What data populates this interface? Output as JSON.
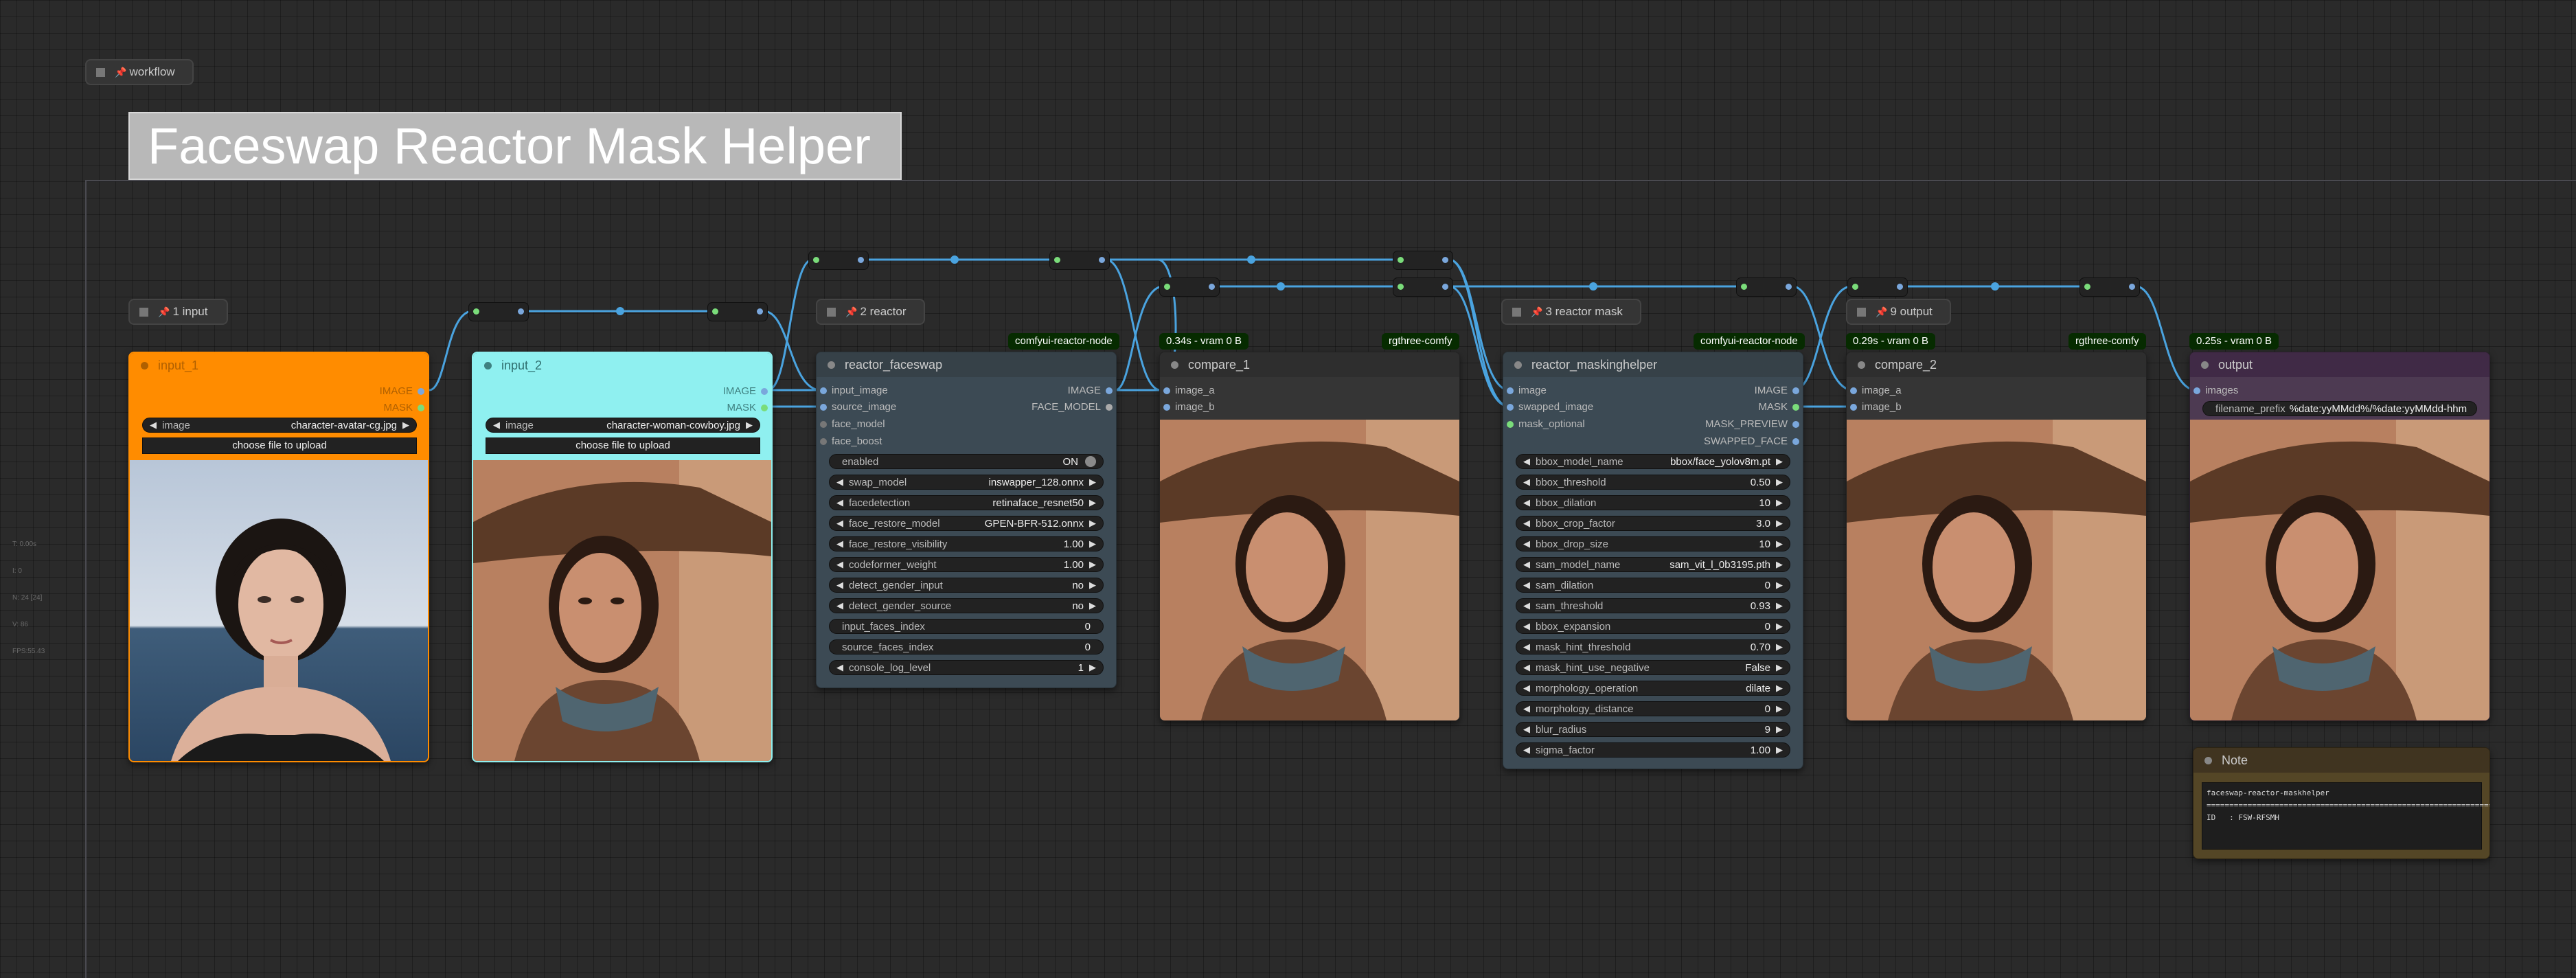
{
  "colors": {
    "wire": "#4aa3df",
    "wire_green": "#7adc7a",
    "input1_title": "#ff8c00",
    "input2_title": "#8ff0f0",
    "output_title": "#402a46",
    "node_body": "#3c4a54",
    "note_title": "#403420"
  },
  "stats": [
    "T: 0.00s",
    "I: 0",
    "N: 24 [24]",
    "V: 86",
    "FPS:55.43"
  ],
  "groups": {
    "workflow": "workflow",
    "input": "1 input",
    "reactor": "2 reactor",
    "reactor_mask": "3 reactor mask",
    "output": "9 output"
  },
  "page_title": "Faceswap Reactor Mask Helper",
  "input_1": {
    "title": "input_1",
    "out_image": "IMAGE",
    "out_mask": "MASK",
    "image_widget_label": "image",
    "image_widget_value": "character-avatar-cg.jpg",
    "upload_label": "choose file to upload"
  },
  "input_2": {
    "title": "input_2",
    "out_image": "IMAGE",
    "out_mask": "MASK",
    "image_widget_label": "image",
    "image_widget_value": "character-woman-cowboy.jpg",
    "upload_label": "choose file to upload"
  },
  "reactor_faceswap": {
    "badge": "comfyui-reactor-node",
    "title": "reactor_faceswap",
    "inputs": [
      "input_image",
      "source_image",
      "face_model",
      "face_boost"
    ],
    "outputs": [
      "IMAGE",
      "FACE_MODEL"
    ],
    "widgets": [
      {
        "label": "enabled",
        "value": "ON"
      },
      {
        "label": "swap_model",
        "value": "inswapper_128.onnx"
      },
      {
        "label": "facedetection",
        "value": "retinaface_resnet50"
      },
      {
        "label": "face_restore_model",
        "value": "GPEN-BFR-512.onnx"
      },
      {
        "label": "face_restore_visibility",
        "value": "1.00"
      },
      {
        "label": "codeformer_weight",
        "value": "1.00"
      },
      {
        "label": "detect_gender_input",
        "value": "no"
      },
      {
        "label": "detect_gender_source",
        "value": "no"
      },
      {
        "label": "input_faces_index",
        "value": "0"
      },
      {
        "label": "source_faces_index",
        "value": "0"
      },
      {
        "label": "console_log_level",
        "value": "1"
      }
    ]
  },
  "compare_1": {
    "timing": "0.34s - vram 0 B",
    "badge": "rgthree-comfy",
    "title": "compare_1",
    "inputs": [
      "image_a",
      "image_b"
    ]
  },
  "reactor_maskinghelper": {
    "badge": "comfyui-reactor-node",
    "title": "reactor_maskinghelper",
    "inputs": [
      "image",
      "swapped_image",
      "mask_optional"
    ],
    "outputs": [
      "IMAGE",
      "MASK",
      "MASK_PREVIEW",
      "SWAPPED_FACE"
    ],
    "widgets": [
      {
        "label": "bbox_model_name",
        "value": "bbox/face_yolov8m.pt"
      },
      {
        "label": "bbox_threshold",
        "value": "0.50"
      },
      {
        "label": "bbox_dilation",
        "value": "10"
      },
      {
        "label": "bbox_crop_factor",
        "value": "3.0"
      },
      {
        "label": "bbox_drop_size",
        "value": "10"
      },
      {
        "label": "sam_model_name",
        "value": "sam_vit_l_0b3195.pth"
      },
      {
        "label": "sam_dilation",
        "value": "0"
      },
      {
        "label": "sam_threshold",
        "value": "0.93"
      },
      {
        "label": "bbox_expansion",
        "value": "0"
      },
      {
        "label": "mask_hint_threshold",
        "value": "0.70"
      },
      {
        "label": "mask_hint_use_negative",
        "value": "False"
      },
      {
        "label": "morphology_operation",
        "value": "dilate"
      },
      {
        "label": "morphology_distance",
        "value": "0"
      },
      {
        "label": "blur_radius",
        "value": "9"
      },
      {
        "label": "sigma_factor",
        "value": "1.00"
      }
    ]
  },
  "compare_2": {
    "timing": "0.29s - vram 0 B",
    "badge": "rgthree-comfy",
    "title": "compare_2",
    "inputs": [
      "image_a",
      "image_b"
    ]
  },
  "output": {
    "timing": "0.25s - vram 0 B",
    "title": "output",
    "input": "images",
    "widget_label": "filename_prefix",
    "widget_value": "%date:yyMMdd%/%date:yyMMdd-hhm"
  },
  "note": {
    "title": "Note",
    "line1": "faceswap-reactor-maskhelper",
    "line2": "================================================================",
    "line3": "ID   : FSW-RFSMH"
  }
}
